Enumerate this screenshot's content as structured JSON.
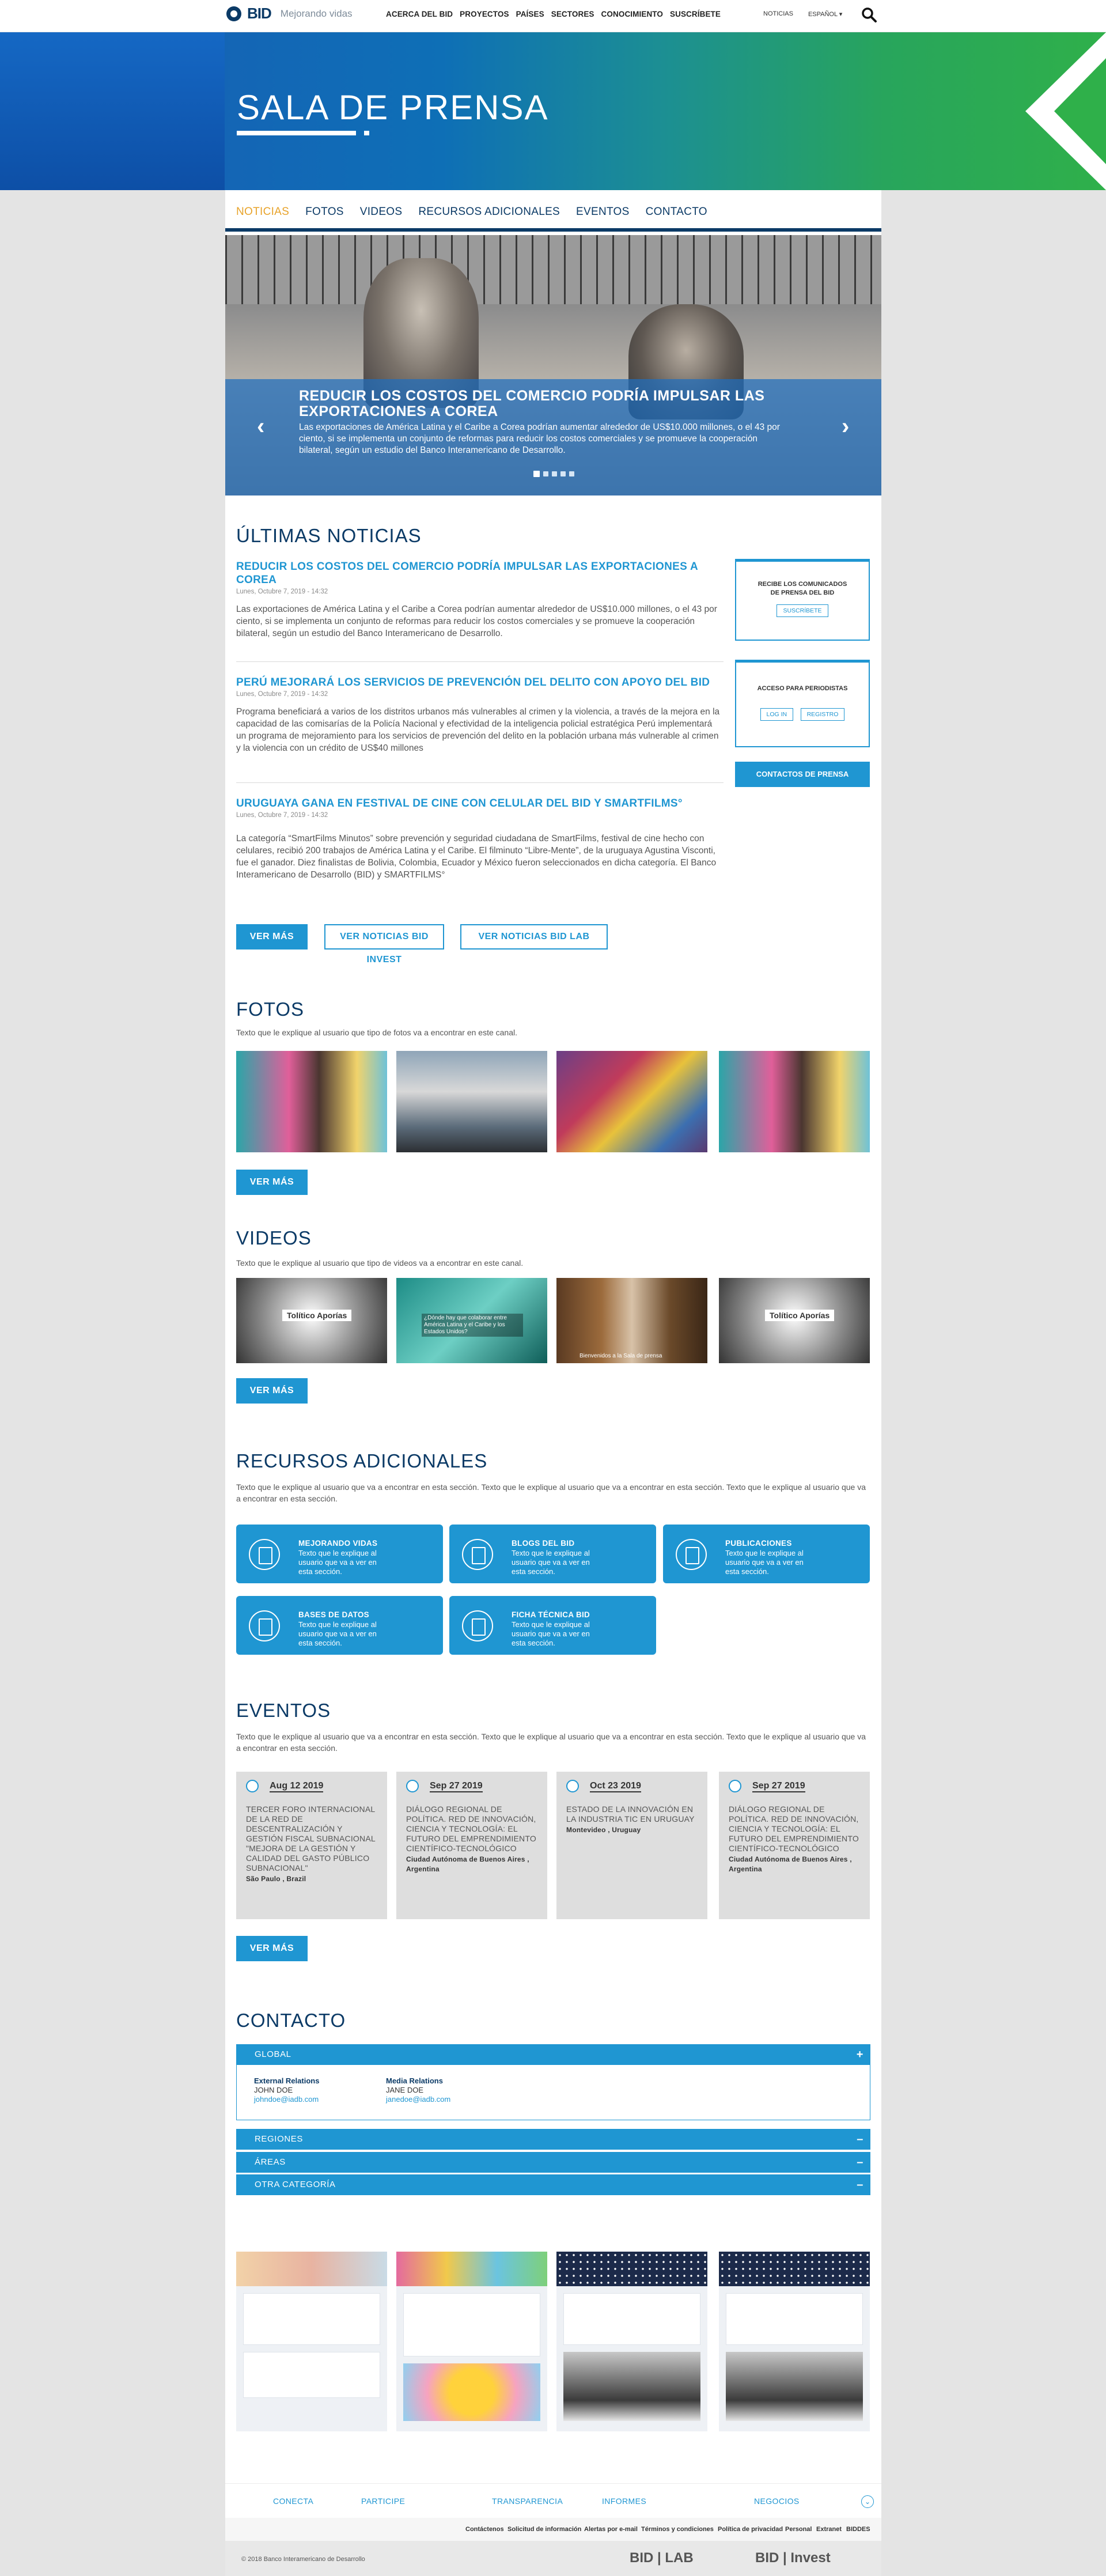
{
  "header": {
    "logo_text": "BID",
    "tagline": "Mejorando vidas",
    "nav": [
      "ACERCA DEL BID",
      "PROYECTOS",
      "PAÍSES",
      "SECTORES",
      "CONOCIMIENTO",
      "SUSCRÍBETE"
    ],
    "util": [
      "NOTICIAS",
      "ESPAÑOL ▾"
    ]
  },
  "hero": {
    "title": "SALA DE PRENSA"
  },
  "section_nav": [
    "NOTICIAS",
    "FOTOS",
    "VIDEOS",
    "RECURSOS ADICIONALES",
    "EVENTOS",
    "CONTACTO"
  ],
  "carousel": {
    "title": "REDUCIR LOS COSTOS DEL COMERCIO PODRÍA IMPULSAR LAS EXPORTACIONES A COREA",
    "text": "Las exportaciones de América Latina y el Caribe a Corea podrían aumentar alrededor de US$10.000 millones, o el 43 por ciento, si se implementa un conjunto de reformas para reducir los costos comerciales y se promueve la cooperación bilateral, según un estudio del Banco Interamericano de Desarrollo."
  },
  "news": {
    "heading": "ÚLTIMAS NOTICIAS",
    "items": [
      {
        "title": "REDUCIR LOS COSTOS DEL COMERCIO PODRÍA IMPULSAR LAS EXPORTACIONES A COREA",
        "date": "Lunes, Octubre 7, 2019 - 14:32",
        "body": "Las exportaciones de América Latina y el Caribe a Corea podrían aumentar alrededor de US$10.000 millones, o el 43 por ciento, si se implementa un conjunto de reformas para reducir los costos comerciales y se promueve la cooperación bilateral, según un estudio del Banco Interamericano de Desarrollo."
      },
      {
        "title": "PERÚ MEJORARÁ LOS SERVICIOS DE PREVENCIÓN DEL DELITO CON APOYO DEL BID",
        "date": "Lunes, Octubre 7, 2019 - 14:32",
        "body": "Programa beneficiará a varios de los distritos urbanos más vulnerables al crimen y la violencia, a través de la mejora en la capacidad de las comisarías de la Policía Nacional y efectividad de la inteligencia policial estratégica Perú implementará un programa de mejoramiento para los servicios de prevención del delito en la población urbana más vulnerable al crimen y la violencia con un crédito de US$40 millones"
      },
      {
        "title": "URUGUAYA GANA EN FESTIVAL DE CINE CON CELULAR DEL BID Y SMARTFILMS°",
        "date": "Lunes, Octubre 7, 2019 - 14:32",
        "body": "La categoría “SmartFilms Minutos” sobre prevención y seguridad ciudadana de SmartFilms, festival de cine hecho con celulares, recibió 200 trabajos de América Latina y el Caribe. El filminuto “Libre-Mente”, de la uruguaya Agustina Visconti, fue el ganador. Diez finalistas de Bolivia, Colombia, Ecuador y México fueron seleccionados en dicha categoría. El Banco Interamericano de Desarrollo (BID) y SMARTFILMS°"
      }
    ],
    "buttons": [
      "VER MÁS",
      "VER NOTICIAS BID INVEST",
      "VER NOTICIAS BID LAB"
    ],
    "sidebar": {
      "subscribe_label": "RECIBE LOS COMUNICADOS DE PRENSA DEL BID",
      "subscribe_btn": "SUSCRÍBETE",
      "journalist_label": "ACCESO PARA PERIODISTAS",
      "login_btn": "LOG IN",
      "register_btn": "REGISTRO",
      "contacts_btn": "CONTACTOS DE PRENSA"
    }
  },
  "fotos": {
    "heading": "FOTOS",
    "sub": "Texto que le explique al usuario que tipo de fotos va a encontrar en este canal.",
    "more": "VER MÁS"
  },
  "videos": {
    "heading": "VIDEOS",
    "sub": "Texto que le explique al usuario que tipo de videos va a encontrar en este canal.",
    "more": "VER MÁS",
    "badges": [
      "Tolítico Aporías",
      "Tolítico Aporías"
    ],
    "captions": [
      "¿Dónde hay que colaborar entre América Latina y el Caribe y los Estados Unidos?",
      "Bienvenidos a la Sala de prensa"
    ]
  },
  "recursos": {
    "heading": "RECURSOS ADICIONALES",
    "sub": "Texto que le explique al usuario que va a encontrar en esta sección. Texto que le explique al usuario que va a encontrar en esta sección. Texto que le explique al usuario que va a encontrar en esta sección.",
    "items": [
      {
        "title": "MEJORANDO VIDAS",
        "desc": "Texto que le explique al usuario que va a ver en esta sección."
      },
      {
        "title": "BLOGS DEL BID",
        "desc": "Texto que le explique al usuario que va a ver en esta sección."
      },
      {
        "title": "PUBLICACIONES",
        "desc": "Texto que le explique al usuario que va a ver en esta sección."
      },
      {
        "title": "BASES DE DATOS",
        "desc": "Texto que le explique al usuario que va a ver en esta sección."
      },
      {
        "title": "FICHA TÉCNICA BID",
        "desc": "Texto que le explique al usuario que va a ver en esta sección."
      }
    ]
  },
  "eventos": {
    "heading": "EVENTOS",
    "sub": "Texto que le explique al usuario que va a encontrar en esta sección. Texto que le explique al usuario que va a encontrar en esta sección. Texto que le explique al usuario que va a encontrar en esta sección.",
    "items": [
      {
        "date": "Aug 12 2019",
        "title": "TERCER FORO INTERNACIONAL DE LA RED DE DESCENTRALIZACIÓN Y GESTIÓN FISCAL SUBNACIONAL \"MEJORA DE LA GESTIÓN Y CALIDAD DEL GASTO PÚBLICO SUBNACIONAL\"",
        "place": "São Paulo , Brazil"
      },
      {
        "date": "Sep 27 2019",
        "title": "DIÁLOGO REGIONAL DE POLÍTICA. RED DE INNOVACIÓN, CIENCIA Y TECNOLOGÍA: EL FUTURO DEL EMPRENDIMIENTO CIENTÍFICO-TECNOLÓGICO",
        "place": "Ciudad Autónoma de Buenos Aires , Argentina"
      },
      {
        "date": "Oct 23 2019",
        "title": "ESTADO DE LA INNOVACIÓN EN LA INDUSTRIA TIC EN URUGUAY",
        "place": "Montevideo , Uruguay"
      },
      {
        "date": "Sep 27 2019",
        "title": "DIÁLOGO REGIONAL DE POLÍTICA. RED DE INNOVACIÓN, CIENCIA Y TECNOLOGÍA: EL FUTURO DEL EMPRENDIMIENTO CIENTÍFICO-TECNOLÓGICO",
        "place": "Ciudad Autónoma de Buenos Aires , Argentina"
      }
    ],
    "more": "VER MÁS"
  },
  "contacto": {
    "heading": "CONTACTO",
    "global": "GLOBAL",
    "external_label": "External Relations",
    "external_name": "JOHN DOE",
    "external_email": "johndoe@iadb.com",
    "media_label": "Media Relations",
    "media_name": "JANE DOE",
    "media_email": "janedoe@iadb.com",
    "rows": [
      "REGIONES",
      "ÁREAS",
      "OTRA CATEGORÍA"
    ]
  },
  "footer": {
    "main": [
      "CONECTA",
      "PARTICIPE",
      "TRANSPARENCIA",
      "INFORMES",
      "NEGOCIOS"
    ],
    "links": [
      "Contáctenos",
      "Solicitud de información",
      "Alertas por e-mail",
      "Términos y condiciones",
      "Política de privacidad",
      "Personal",
      "Extranet",
      "BIDDES"
    ],
    "copyright": "© 2018 Banco Interamericano de Desarrollo",
    "logo_lab": "BID | LAB",
    "logo_invest": "BID | Invest"
  },
  "colors": {
    "navy": "#0b3a66",
    "accent": "#1f96d2",
    "orange": "#e8a32a"
  }
}
